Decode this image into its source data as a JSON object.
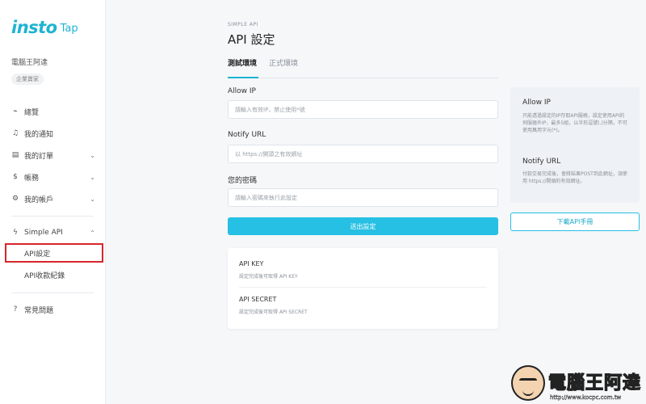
{
  "brand": {
    "logo_main": "insto",
    "logo_sub": "Tap"
  },
  "user": {
    "name": "電腦王阿達",
    "badge": "企業賣家"
  },
  "sidebar": {
    "items": [
      {
        "icon": "activity-icon",
        "glyph": "⌁",
        "label": "總覽"
      },
      {
        "icon": "bell-icon",
        "glyph": "♫",
        "label": "我的通知"
      },
      {
        "icon": "document-icon",
        "glyph": "▤",
        "label": "我的訂單",
        "chevron": "⌄"
      },
      {
        "icon": "dollar-icon",
        "glyph": "$",
        "label": "帳務",
        "chevron": "⌄"
      },
      {
        "icon": "gear-icon",
        "glyph": "⚙",
        "label": "我的帳戶",
        "chevron": "⌄"
      }
    ],
    "api_section": {
      "icon": "lightning-icon",
      "glyph": "ϟ",
      "label": "Simple API",
      "chevron": "⌃"
    },
    "sub_items": [
      {
        "label": "API設定",
        "active": true
      },
      {
        "label": "API收款紀錄",
        "active": false
      }
    ],
    "help": {
      "icon": "question-circle-icon",
      "glyph": "?",
      "label": "常見問題"
    }
  },
  "main": {
    "eyebrow": "SIMPLE API",
    "title": "API 設定",
    "tabs": [
      {
        "label": "測試環境",
        "active": true
      },
      {
        "label": "正式環境",
        "active": false
      }
    ],
    "form": {
      "allow_ip": {
        "label": "Allow IP",
        "placeholder": "請輸入有效IP，禁止使用*號",
        "value": ""
      },
      "notify_url": {
        "label": "Notify URL",
        "placeholder": "以 https://開頭之有效網址",
        "value": ""
      },
      "password": {
        "label": "您的密碼",
        "placeholder": "請輸入密碼來執行此設定",
        "value": ""
      },
      "submit_label": "送出設定"
    },
    "keys": [
      {
        "title": "API KEY",
        "desc": "設定完成後可取得 API KEY"
      },
      {
        "title": "API SECRET",
        "desc": "設定完成後可取得 API SECRET"
      }
    ]
  },
  "info": {
    "allow_ip": {
      "title": "Allow IP",
      "text": "只能透過設定的IP存取API服務，設定使用API的伺服器外IP，最多5組，以半形逗號(,)分隔，不可使用萬用字元(*)。"
    },
    "notify_url": {
      "title": "Notify URL",
      "text": "付款交易完成後，會將結果POST到此網址，須使用 https://開頭的有效網址。"
    },
    "download_label": "下載API手冊"
  },
  "watermark": {
    "brand": "電腦王阿達",
    "url": "http://www.kocpc.com.tw"
  },
  "colors": {
    "accent": "#25c0e3",
    "logo": "#1fb3d2",
    "highlight": "#d6262c"
  }
}
